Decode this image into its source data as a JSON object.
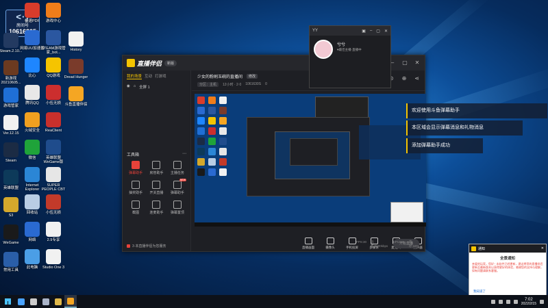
{
  "room_badge": {
    "logo": "<·)",
    "title": "房间号",
    "number": "10616305"
  },
  "desktop_icons": [
    {
      "name": "Steam",
      "label": "Steam的...",
      "color": "#1b3a63"
    },
    {
      "name": "stream-app",
      "label": "Steam.2.10...",
      "color": "#233a61"
    },
    {
      "name": "game-win",
      "label": "新游戏\n20210605...",
      "color": "#6b3a20"
    },
    {
      "name": "game-helper",
      "label": "游戏管家",
      "color": "#1f6fd6"
    },
    {
      "name": "ver",
      "label": "Ver.12.15",
      "color": "#f1f1f1"
    },
    {
      "name": "steam2",
      "label": "Steam",
      "color": "#1b2b44"
    },
    {
      "name": "lol",
      "label": "英雄联盟",
      "color": "#0d3a5a"
    },
    {
      "name": "s3",
      "label": "S3",
      "color": "#d4a82c"
    },
    {
      "name": "wegame",
      "label": "WeGame",
      "color": "#1a1a1a"
    },
    {
      "name": "tools",
      "label": "常用工具",
      "color": "#2a5ea8"
    }
  ],
  "desktop_icons_col2": [
    {
      "label": "极速PDF",
      "color": "#d93c2b"
    },
    {
      "label": "网易UU加速器",
      "color": "#2a6ad1"
    },
    {
      "label": "比心",
      "color": "#1e86ff"
    },
    {
      "label": "腾讯QQ",
      "color": "#e8e8e8"
    },
    {
      "label": "火绒安全",
      "color": "#f0a020"
    },
    {
      "label": "微信",
      "color": "#1fa33a"
    },
    {
      "label": "Internet Explorer",
      "color": "#2b86d6"
    },
    {
      "label": "回收站",
      "color": "#b9cde4"
    },
    {
      "label": "网络",
      "color": "#2a6ad1"
    },
    {
      "label": "此电脑",
      "color": "#4b9ee6"
    }
  ],
  "desktop_icons_col3": [
    {
      "label": "游戏中心",
      "color": "#f07d1a"
    },
    {
      "label": "STEAM游戏管家_bot...",
      "color": "#2b57a0"
    },
    {
      "label": "QQ游戏",
      "color": "#f5c400"
    },
    {
      "label": "小伍无损",
      "color": "#cc2e2e"
    },
    {
      "label": "ReaClient",
      "color": "#c8302c"
    },
    {
      "label": "英雄联盟WeGame版",
      "color": "#1f4c8c"
    },
    {
      "label": "SUPER PEOPLE CBT",
      "color": "#e6e6e6"
    },
    {
      "label": "小伍无损",
      "color": "#c23a2a"
    },
    {
      "label": "2.9专享",
      "color": "#f1f1f1"
    },
    {
      "label": "Studio One 3",
      "color": "#f1f1f1"
    }
  ],
  "desktop_icons_col4": [
    {
      "label": "History",
      "color": "#f1f1f1"
    },
    {
      "label": "Dread Hunger",
      "color": "#7a3b2b"
    },
    {
      "label": "斗鱼直播伴侣",
      "color": "#f5a623"
    }
  ],
  "app": {
    "name": "直播伴侣",
    "version": "新版",
    "left_tabs": [
      "我的场景",
      "互动",
      "打游戏"
    ],
    "scene_label": "全屏 1",
    "toolbox_label": "工具箱",
    "tools": [
      {
        "label": "弹幕助手",
        "active": true,
        "badge": ""
      },
      {
        "label": "房管助手",
        "active": false,
        "badge": ""
      },
      {
        "label": "主播任务",
        "active": false,
        "badge": ""
      },
      {
        "label": "抽奖助手",
        "active": false,
        "badge": ""
      },
      {
        "label": "开关直播",
        "active": false,
        "badge": ""
      },
      {
        "label": "弹幕助手",
        "active": false,
        "badge": "NEW"
      },
      {
        "label": "截图",
        "active": false,
        "badge": ""
      },
      {
        "label": "连麦助手",
        "active": false,
        "badge": ""
      },
      {
        "label": "弹幕置顶",
        "active": false,
        "badge": ""
      }
    ],
    "left_status": "3·本直播伴侣为您服务",
    "stream_title": "少女的粉刷玉碗的直播间",
    "stream_title_edit": "修改",
    "stream_meta": [
      "分区：主机",
      "12小时 · 2·0",
      "1061630S",
      "0"
    ],
    "controls": [
      "直播画面",
      "摄像头",
      "手机投屏",
      "多媒体",
      "麦克风",
      "扬声器"
    ],
    "start_live": "开始直播",
    "stats": [
      "FPS:30",
      "码率:3000kbps",
      "CPU:5%",
      "内存:16%"
    ]
  },
  "yy": {
    "title": "YY",
    "name": "兮兮",
    "status": "♥最佳主播·直播中"
  },
  "danmaku": [
    "欢迎使用斗鱼弹幕助手",
    "本区域会显示弹幕消息和礼物消息",
    "添加弹幕助手成功"
  ],
  "notice": {
    "app": "通知",
    "title": "全景通知",
    "body": "亲爱的玩家，您好~ 本软件已经更新，建议将您的直播伴侣更新至最新版本以获得更好的体验，感谢您的支持与理解，如有问题请联系客服。",
    "link": "我知道了"
  },
  "taskbar": {
    "time": "7:02",
    "date": "2022/2/15",
    "apps": [
      {
        "name": "start-app",
        "color": "#4aa3ff"
      },
      {
        "name": "settings-app",
        "color": "#ccc"
      },
      {
        "name": "steam-app",
        "color": "#aab4c8"
      },
      {
        "name": "folder-app",
        "color": "#e0b84a"
      },
      {
        "name": "live-app",
        "color": "#f5a623",
        "active": true
      }
    ]
  }
}
